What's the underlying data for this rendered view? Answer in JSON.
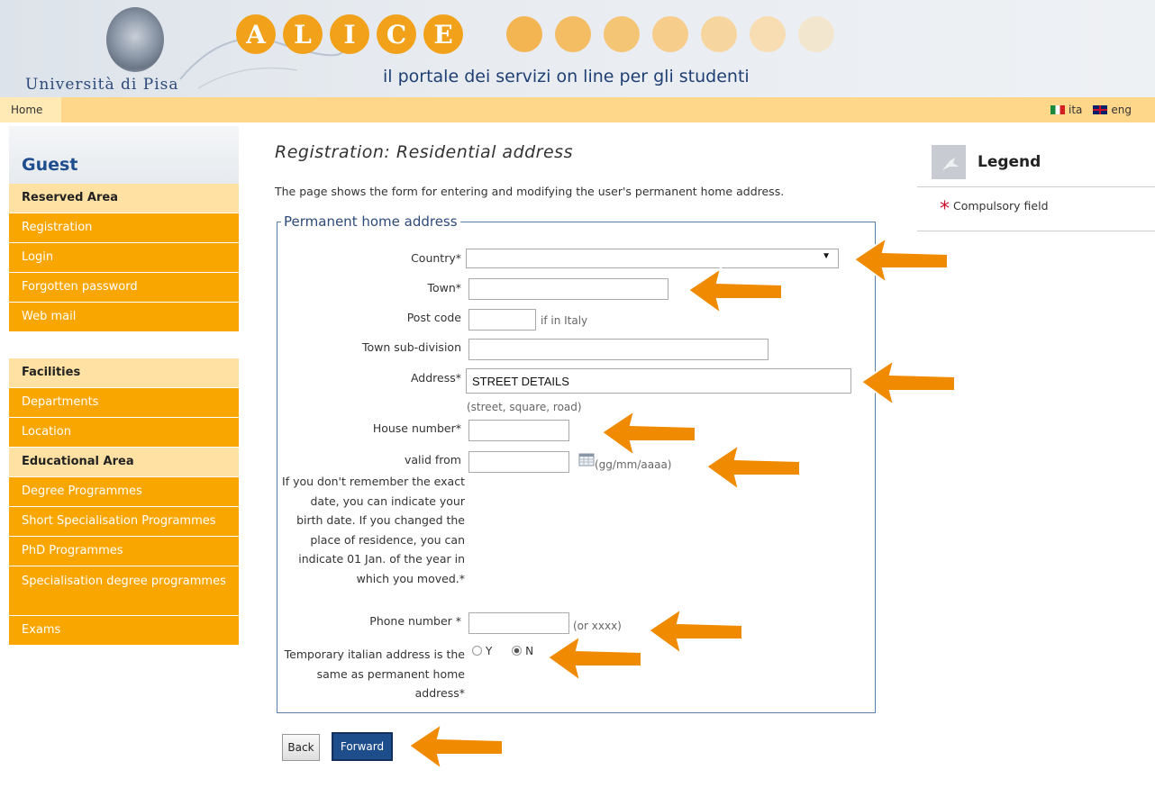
{
  "header": {
    "university": "Università di Pisa",
    "alice_letters": [
      "A",
      "L",
      "I",
      "C",
      "E"
    ],
    "portal_tagline": "il portale dei servizi on line per gli studenti"
  },
  "topbar": {
    "home": "Home",
    "lang_it": "ita",
    "lang_en": "eng"
  },
  "sidebar": {
    "guest": "Guest",
    "reserved_area": "Reserved Area",
    "reserved_items": [
      "Registration",
      "Login",
      "Forgotten password",
      "Web mail"
    ],
    "facilities": "Facilities",
    "facilities_items": [
      "Departments",
      "Location"
    ],
    "educational_area": "Educational Area",
    "educational_items": [
      "Degree Programmes",
      "Short Specialisation Programmes",
      "PhD Programmes",
      "Specialisation degree programmes",
      "Exams"
    ]
  },
  "main": {
    "title": "Registration: Residential address",
    "description": "The page shows the form for entering and modifying the user's permanent home address.",
    "fieldset_legend": "Permanent home address",
    "fields": {
      "country_label": "Country*",
      "country_value": "",
      "town_label": "Town*",
      "post_code_label": "Post code",
      "post_code_hint": "if in Italy",
      "town_subdivision_label": "Town sub-division",
      "address_label": "Address*",
      "address_value": "STREET DETAILS",
      "address_hint": "(street, square, road)",
      "house_number_label": "House number*",
      "house_number_value": "",
      "valid_from_label": "valid from",
      "valid_from_note": "If you don't remember the exact date, you can indicate your birth date. If you changed the place of residence, you can indicate 01 Jan. of the year in which you moved.*",
      "date_hint": "(gg/mm/aaaa)",
      "phone_label": "Phone number *",
      "phone_hint": "(or xxxx)",
      "temp_address_label": "Temporary italian address is the same as permanent home address*",
      "radio_yes": "Y",
      "radio_no": "N",
      "radio_selected": "N"
    },
    "buttons": {
      "back": "Back",
      "forward": "Forward"
    }
  },
  "legend_panel": {
    "title": "Legend",
    "compulsory": "Compulsory field"
  },
  "colors": {
    "accent_orange": "#f9a600",
    "nav_light": "#ffe2a3",
    "brand_blue": "#1e4d8c",
    "annotation_arrow": "#f08a00"
  }
}
